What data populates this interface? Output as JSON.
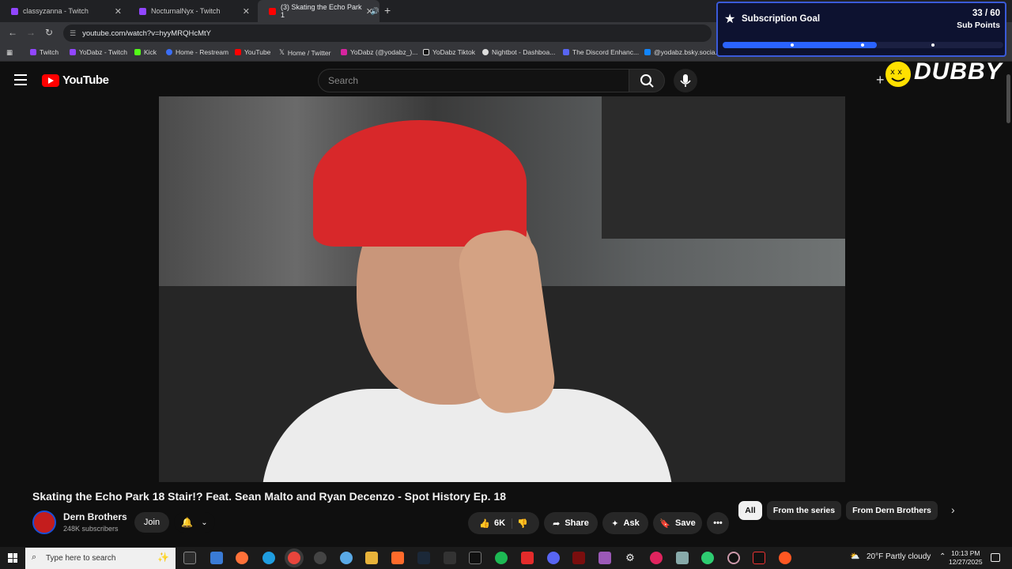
{
  "browser": {
    "tabs": [
      {
        "label": "classyzanna - Twitch",
        "favicon_color": "#9146ff"
      },
      {
        "label": "NocturnalNyx - Twitch",
        "favicon_color": "#9146ff"
      },
      {
        "label": "(3) Skating the Echo Park 1",
        "favicon_color": "#ff0000"
      }
    ],
    "url": "youtube.com/watch?v=hyyMRQHcMtY",
    "bookmarks": [
      "Twitch",
      "YoDabz - Twitch",
      "Kick",
      "Home - Restream",
      "YouTube",
      "Home / Twitter",
      "YoDabz (@yodabz_)...",
      "YoDabz Tiktok",
      "Nightbot - Dashboa...",
      "The Discord Enhanc...",
      "@yodabz.bsky.socia..."
    ]
  },
  "sub_goal": {
    "title": "Subscription Goal",
    "count": "33 / 60",
    "unit": "Sub Points",
    "progress_fraction": 0.55
  },
  "youtube": {
    "logo_text": "YouTube",
    "search_placeholder": "Search",
    "overlay_logo": "DUBBY",
    "video_title": "Skating the Echo Park 18 Stair!? Feat. Sean Malto and Ryan Decenzo - Spot History Ep. 18",
    "channel_name": "Dern Brothers",
    "channel_subs": "248K subscribers",
    "join_label": "Join",
    "like_count": "6K",
    "share_label": "Share",
    "ask_label": "Ask",
    "save_label": "Save",
    "chips": [
      "All",
      "From the series",
      "From Dern Brothers"
    ]
  },
  "taskbar": {
    "search_placeholder": "Type here to search",
    "weather": "20°F  Partly cloudy",
    "time": "10:13 PM",
    "date": "12/27/2025"
  }
}
